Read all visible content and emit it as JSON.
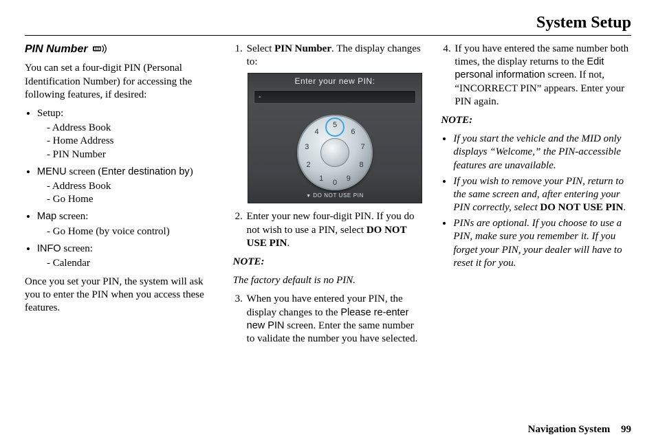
{
  "header": {
    "title": "System Setup"
  },
  "col1": {
    "subhead": "PIN Number",
    "intro": "You can set a four-digit PIN (Personal Identification Number) for accessing the following features, if desired:",
    "groups": [
      {
        "label_pre": "",
        "label_sans": "",
        "label_post": "Setup:",
        "items": [
          "Address Book",
          "Home Address",
          "PIN Number"
        ]
      },
      {
        "label_pre": "",
        "label_sans": "MENU",
        "label_post": " screen (",
        "label_sans2": "Enter destination by",
        "label_tail": ")",
        "items": [
          "Address Book",
          "Go Home"
        ]
      },
      {
        "label_pre": "",
        "label_sans": "Map",
        "label_post": " screen:",
        "items": [
          "Go Home (by voice control)"
        ]
      },
      {
        "label_pre": "",
        "label_sans": "INFO",
        "label_post": " screen:",
        "items": [
          "Calendar"
        ]
      }
    ],
    "outro": "Once you set your PIN, the system will ask you to enter the PIN when you access these features."
  },
  "col2": {
    "step1_a": "Select ",
    "step1_b": "PIN Number",
    "step1_c": ". The display changes to:",
    "pin_screen": {
      "title": "Enter your new PIN:",
      "field_value": "-",
      "footer": "DO NOT USE PIN"
    },
    "step2_a": "Enter your new four-digit PIN. If you do not wish to use a PIN, select ",
    "step2_b": "DO NOT USE PIN",
    "step2_c": ".",
    "note_head": "NOTE:",
    "note_body": "The factory default is no PIN.",
    "step3_a": "When you have entered your PIN, the display changes to the ",
    "step3_b": "Please re-enter new PIN",
    "step3_c": " screen. Enter the same number to validate the number you have selected."
  },
  "col3": {
    "step4_a": "If you have entered the same number both times, the display returns to the ",
    "step4_b": "Edit personal information",
    "step4_c": " screen. If not, “INCORRECT PIN” appears. Enter your PIN again.",
    "note_head": "NOTE:",
    "notes": [
      {
        "pre": "If you start the vehicle and the MID only displays “Welcome,” the PIN-accessible features are unavailable."
      },
      {
        "pre": "If you wish to remove your PIN, return to the same screen and, after entering your PIN correctly, select ",
        "bold": "DO NOT USE PIN",
        "post": "."
      },
      {
        "pre": "PINs are optional. If you choose to use a PIN, make sure you remember it. If you forget your PIN, your dealer will have to reset it for you."
      }
    ]
  },
  "footer": {
    "label": "Navigation System",
    "page": "99"
  },
  "dial": {
    "numbers": [
      "5",
      "6",
      "7",
      "8",
      "9",
      "0",
      "1",
      "2",
      "3",
      "4"
    ]
  }
}
